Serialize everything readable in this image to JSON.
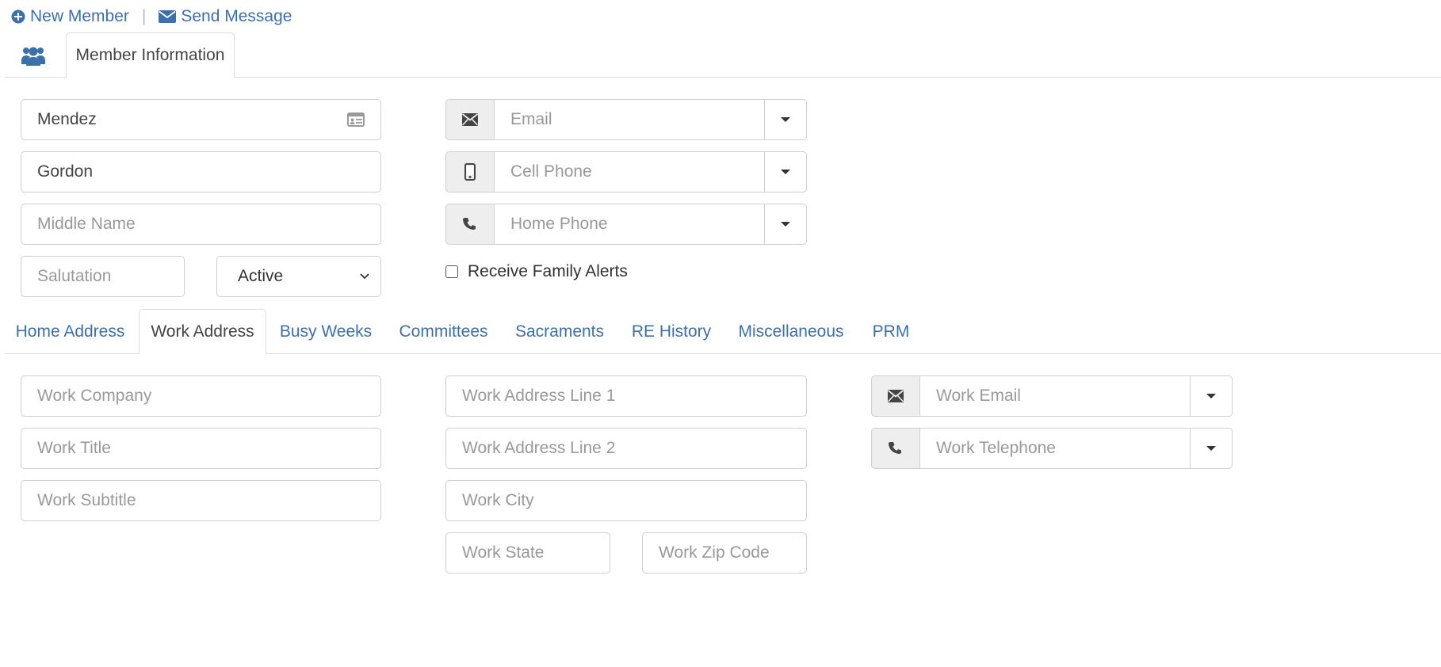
{
  "toolbar": {
    "new_member": "New Member",
    "separator": "|",
    "send_message": "Send Message"
  },
  "main_tabs": {
    "members_icon": "users-icon",
    "member_information": "Member Information"
  },
  "member": {
    "last_name_value": "Mendez",
    "first_name_value": "Gordon",
    "middle_name_placeholder": "Middle Name",
    "salutation_placeholder": "Salutation",
    "status_value": "Active",
    "email_placeholder": "Email",
    "cell_phone_placeholder": "Cell Phone",
    "home_phone_placeholder": "Home Phone",
    "family_alerts_label": "Receive Family Alerts",
    "family_alerts_checked": false
  },
  "section_tabs": [
    {
      "label": "Home Address",
      "active": false
    },
    {
      "label": "Work Address",
      "active": true
    },
    {
      "label": "Busy Weeks",
      "active": false
    },
    {
      "label": "Committees",
      "active": false
    },
    {
      "label": "Sacraments",
      "active": false
    },
    {
      "label": "RE History",
      "active": false
    },
    {
      "label": "Miscellaneous",
      "active": false
    },
    {
      "label": "PRM",
      "active": false
    }
  ],
  "work": {
    "company_placeholder": "Work Company",
    "title_placeholder": "Work Title",
    "subtitle_placeholder": "Work Subtitle",
    "address1_placeholder": "Work Address Line 1",
    "address2_placeholder": "Work Address Line 2",
    "city_placeholder": "Work City",
    "state_placeholder": "Work State",
    "zip_placeholder": "Work Zip Code",
    "email_placeholder": "Work Email",
    "telephone_placeholder": "Work Telephone"
  },
  "colors": {
    "link": "#3b70ad",
    "border": "#cfcfcf",
    "addon_bg": "#eeeeee"
  }
}
